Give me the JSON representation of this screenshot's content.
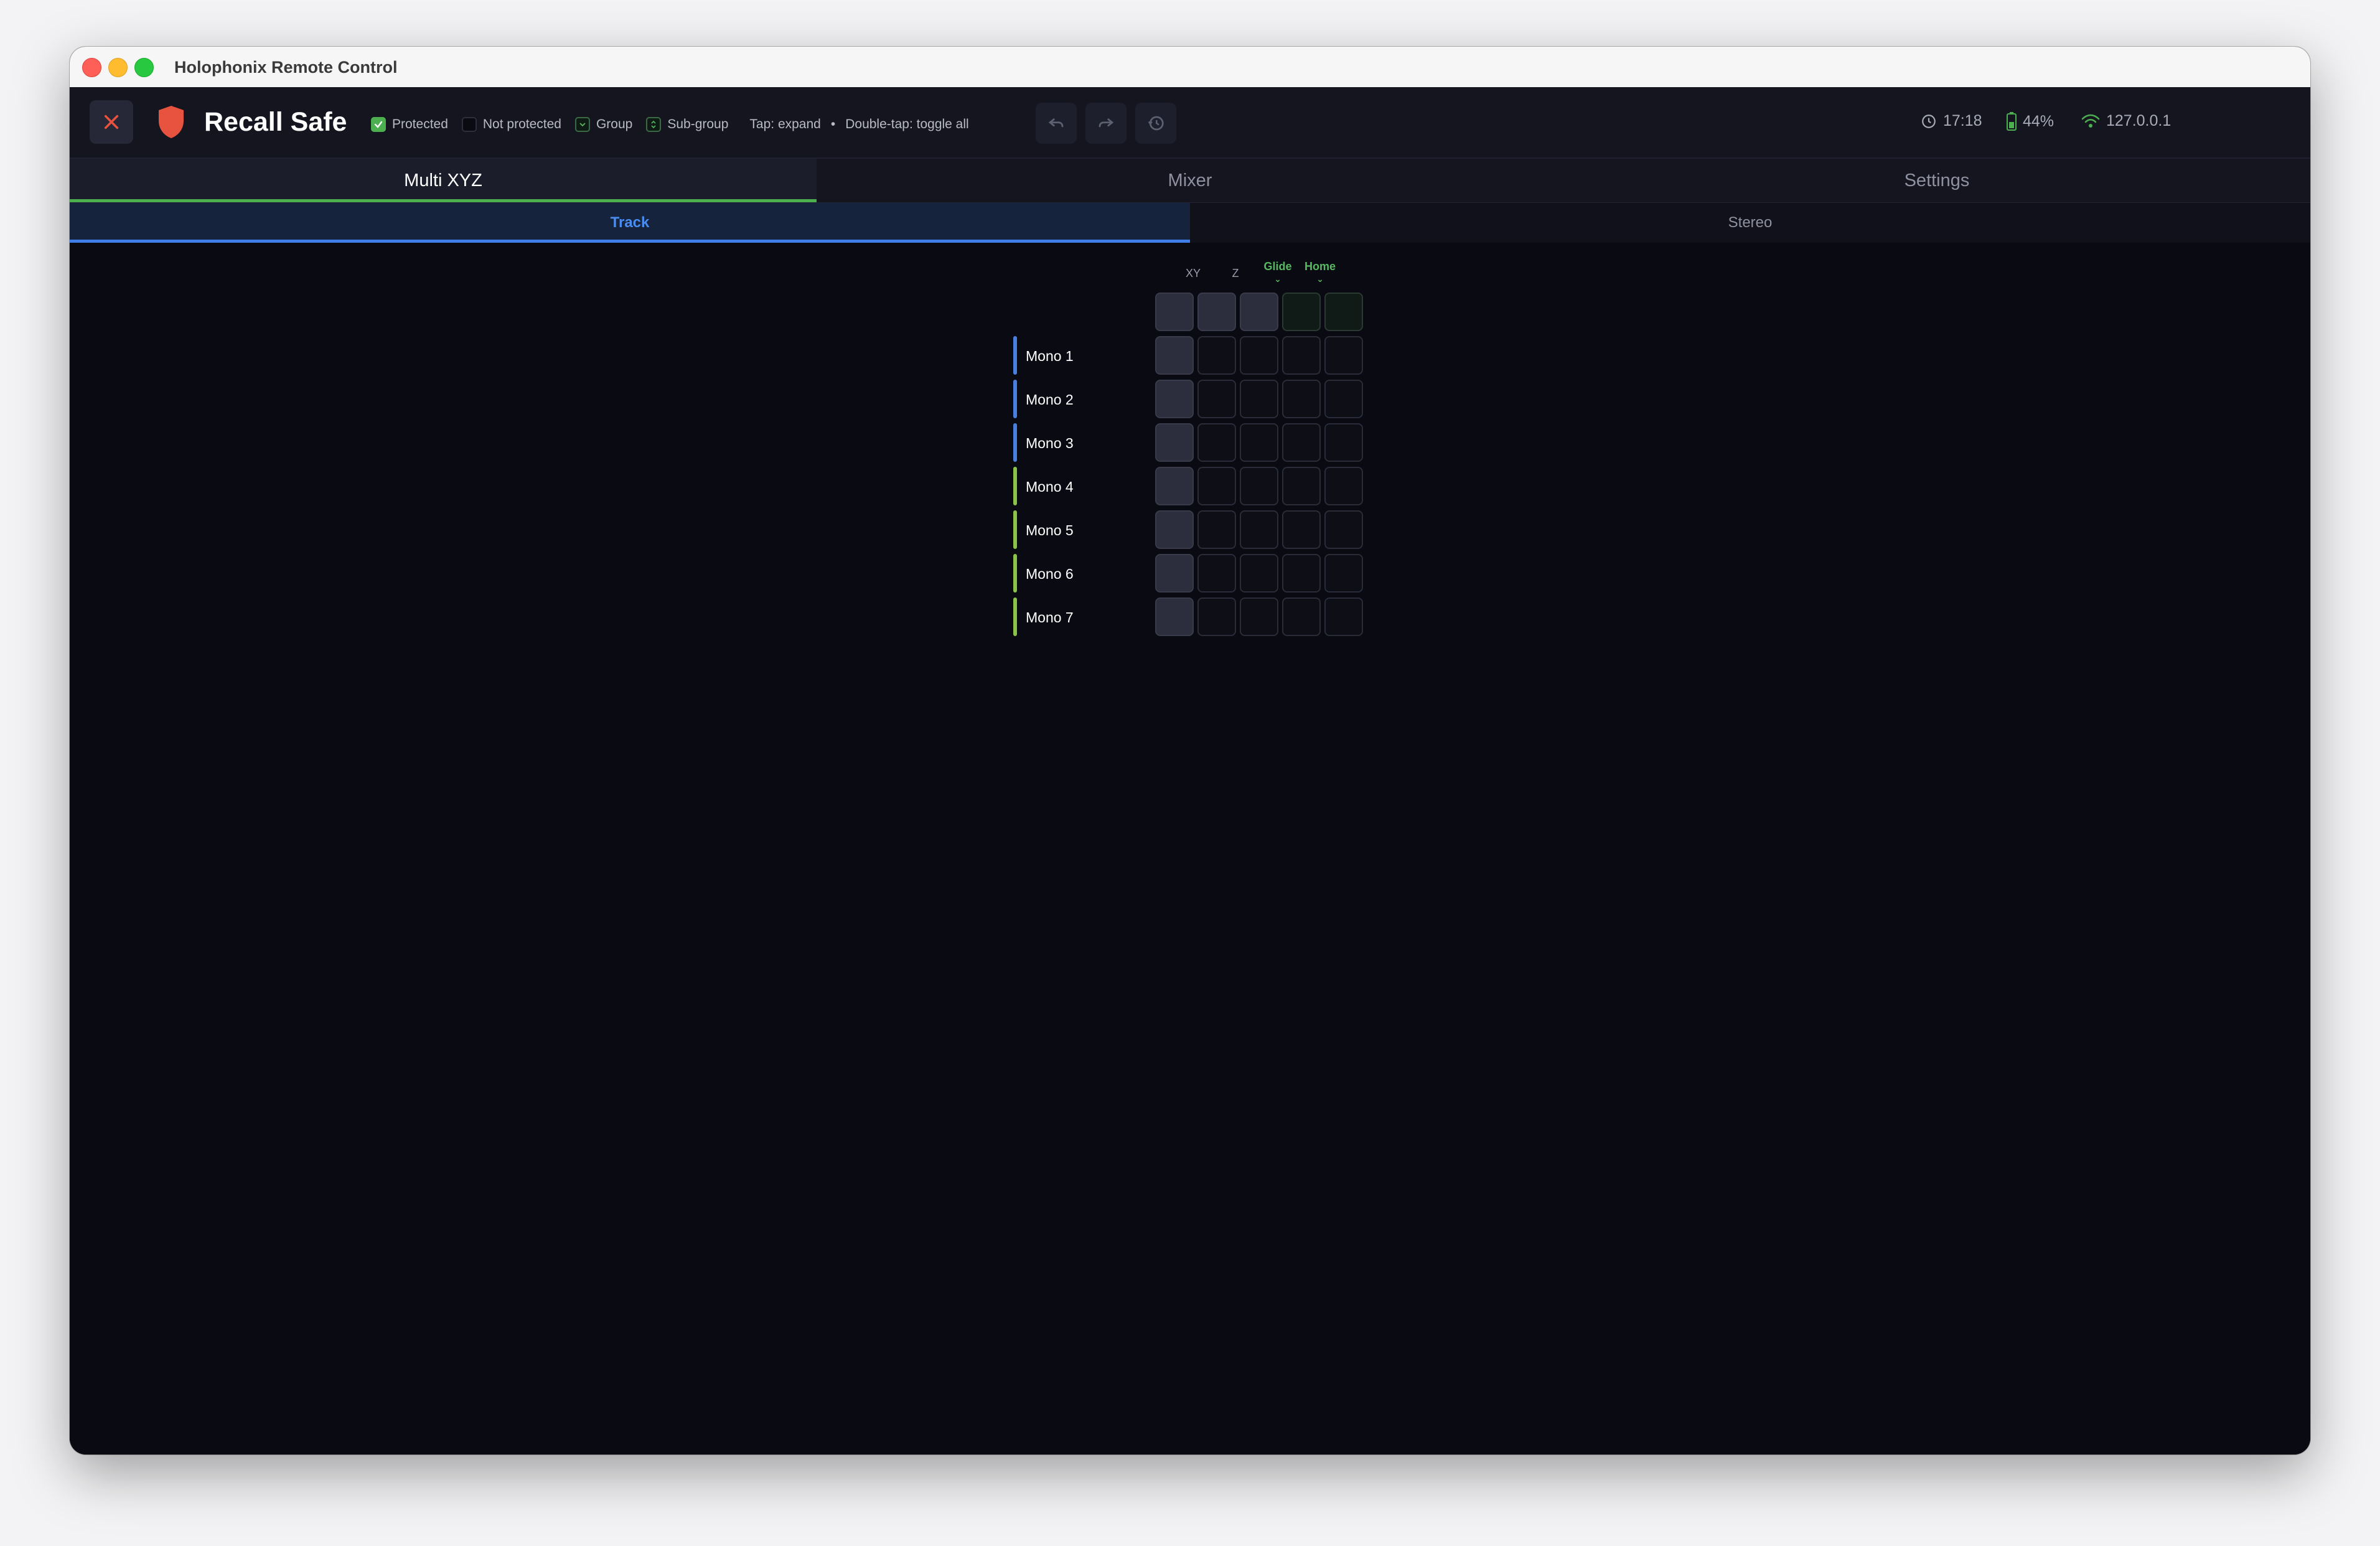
{
  "window": {
    "title": "Holophonix Remote Control"
  },
  "toolbar": {
    "title": "Recall Safe",
    "legend": {
      "protected": "Protected",
      "not_protected": "Not protected",
      "group": "Group",
      "sub_group": "Sub-group"
    },
    "hint_expand": "Tap: expand",
    "hint_separator": "•",
    "hint_toggle": "Double-tap: toggle all"
  },
  "status": {
    "time": "17:18",
    "battery": "44%",
    "ip": "127.0.0.1"
  },
  "colors": {
    "accent_green": "#4caf50",
    "accent_blue": "#3f7ee8",
    "danger_red": "#e8533f",
    "group_blue": "#4a7fe0",
    "group_green": "#8bc34a"
  },
  "tabs": [
    {
      "label": "Multi XYZ",
      "active": true
    },
    {
      "label": "Mixer",
      "active": false
    },
    {
      "label": "Settings",
      "active": false
    }
  ],
  "subtabs": [
    {
      "label": "Track",
      "active": true
    },
    {
      "label": "Stereo",
      "active": false
    }
  ],
  "grid": {
    "columns": [
      "",
      "XY",
      "Z",
      "Glide",
      "Home"
    ],
    "header_row_filled": [
      true,
      true,
      true,
      false,
      false
    ],
    "tracks": [
      {
        "name": "Mono 1",
        "group": "blue"
      },
      {
        "name": "Mono 2",
        "group": "blue"
      },
      {
        "name": "Mono 3",
        "group": "blue"
      },
      {
        "name": "Mono 4",
        "group": "green"
      },
      {
        "name": "Mono 5",
        "group": "green"
      },
      {
        "name": "Mono 6",
        "group": "green"
      },
      {
        "name": "Mono 7",
        "group": "green"
      }
    ]
  }
}
